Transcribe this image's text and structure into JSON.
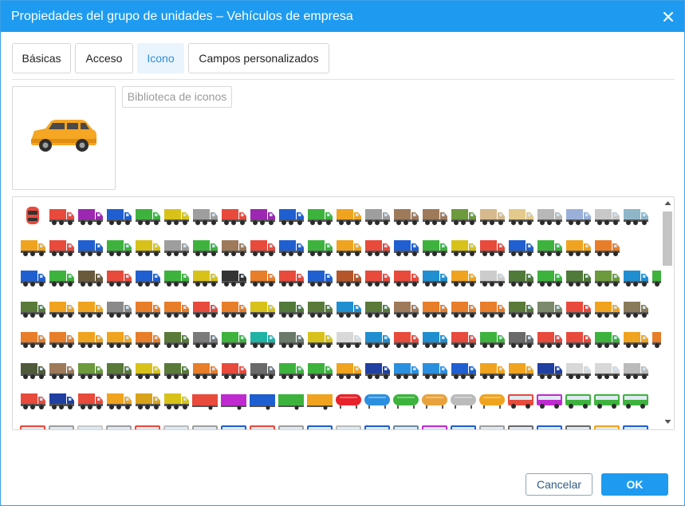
{
  "dialog": {
    "title": "Propiedades del grupo de unidades – Vehículos de empresa",
    "close_icon": "close-icon"
  },
  "tabs": [
    {
      "label": "Básicas",
      "active": false
    },
    {
      "label": "Acceso",
      "active": false
    },
    {
      "label": "Icono",
      "active": true
    },
    {
      "label": "Campos personalizados",
      "active": false
    }
  ],
  "preview": {
    "icon": "suv-car-icon",
    "color": "#f5a623"
  },
  "icon_library": {
    "button_label": "Biblioteca de iconos",
    "rows": [
      {
        "kind": "mixed",
        "colors": [
          "#e84a3c",
          "#e84a3c",
          "#9c27b0",
          "#1f5fd1",
          "#3db33d",
          "#d8c21a",
          "#9e9e9e",
          "#e84a3c",
          "#9c27b0",
          "#1f5fd1",
          "#3db33d",
          "#f0a31f",
          "#9e9e9e",
          "#9e7a5a",
          "#9e7a5a",
          "#6d9a3c",
          "#d6b98c",
          "#e3c98b",
          "#b8b8b8",
          "#9ab0d9",
          "#c8c8c8",
          "#8fb6c8"
        ]
      },
      {
        "kind": "truck",
        "colors": [
          "#f0a31f",
          "#e84a3c",
          "#1f5fd1",
          "#3db33d",
          "#d8c21a",
          "#9e9e9e",
          "#3db33d",
          "#9e7a5a",
          "#e84a3c",
          "#1f5fd1",
          "#3db33d",
          "#f0a31f",
          "#e84a3c",
          "#1f5fd1",
          "#3db33d",
          "#d8c21a",
          "#e84a3c",
          "#1f5fd1",
          "#3db33d",
          "#f0a31f",
          "#e87d2a"
        ]
      },
      {
        "kind": "truck",
        "colors": [
          "#1f5fd1",
          "#3db33d",
          "#6a5a3c",
          "#e84a3c",
          "#1f5fd1",
          "#3db33d",
          "#d8c21a",
          "#333333",
          "#e87d2a",
          "#e84a3c",
          "#1f5fd1",
          "#b5562a",
          "#e84a3c",
          "#e84a3c",
          "#1f8fd1",
          "#f0a31f",
          "#cccccc",
          "#4f7a3a",
          "#3db33d",
          "#4f7a3a",
          "#6d9a3c",
          "#1f8fd1",
          "#3db33d"
        ]
      },
      {
        "kind": "truck",
        "colors": [
          "#5a7a3a",
          "#f0a31f",
          "#f0a31f",
          "#8a8a8a",
          "#e87d2a",
          "#e87d2a",
          "#e84a3c",
          "#e87d2a",
          "#d8c21a",
          "#4f7a3a",
          "#5a7a3a",
          "#1f8fd1",
          "#5a7a3a",
          "#9e7a5a",
          "#e87d2a",
          "#e87d2a",
          "#e87d2a",
          "#5a7a3a",
          "#7a8a6a",
          "#e84a3c",
          "#f0a31f",
          "#8a7a5a"
        ]
      },
      {
        "kind": "truck",
        "colors": [
          "#e87d2a",
          "#e87d2a",
          "#f0a31f",
          "#f0a31f",
          "#e87d2a",
          "#5a7a3a",
          "#7a7a7a",
          "#3db33d",
          "#1fb3a6",
          "#6a7a6a",
          "#d8c21a",
          "#d8d8d8",
          "#1f8fd1",
          "#e84a3c",
          "#1f8fd1",
          "#e84a3c",
          "#3db33d",
          "#6a6a6a",
          "#e84a3c",
          "#e84a3c",
          "#3db33d",
          "#f0a31f",
          "#e87d2a"
        ]
      },
      {
        "kind": "truck",
        "colors": [
          "#4f5a3a",
          "#9e7a5a",
          "#6d9a3c",
          "#5a7a3a",
          "#d8c21a",
          "#5a7a3a",
          "#e87d2a",
          "#e84a3c",
          "#6a6a6a",
          "#3db33d",
          "#3db33d",
          "#f0a31f",
          "#1f3fa1",
          "#2b8fe0",
          "#2b8fe0",
          "#1f5fd1",
          "#f0a31f",
          "#f0a31f",
          "#1f3fa1",
          "#d8d8d8",
          "#d8d8d8",
          "#bbbbbb"
        ]
      },
      {
        "kind": "special",
        "colors": [
          "#e84a3c",
          "#1f3fa1",
          "#e84a3c",
          "#f0a31f",
          "#d8a21a",
          "#d8c21a",
          "#e84a3c",
          "#c02ad1",
          "#1f5fd1",
          "#3db33d",
          "#f0a31f",
          "#e8222a",
          "#2b8fe0",
          "#3db33d",
          "#e8a23c",
          "#bbbbbb",
          "#f0a31f",
          "#e84a3c",
          "#c02ad1",
          "#3db33d",
          "#3db33d",
          "#3db33d"
        ]
      },
      {
        "kind": "bus",
        "colors": [
          "#e84a3c",
          "#9e9e9e",
          "#c8c8c8",
          "#9e9e9e",
          "#e84a3c",
          "#bbbbbb",
          "#9e9e9e",
          "#1f5fd1",
          "#e84a3c",
          "#9e9e9e",
          "#1f5fd1",
          "#bbbbbb",
          "#1f5fd1",
          "#6a8aa1",
          "#c02ad1",
          "#1f5fd1",
          "#9e9e9e",
          "#6a6a6a",
          "#1f5fd1",
          "#6a6a6a",
          "#f0a31f",
          "#1f5fd1"
        ]
      }
    ]
  },
  "footer": {
    "cancel_label": "Cancelar",
    "ok_label": "OK"
  }
}
